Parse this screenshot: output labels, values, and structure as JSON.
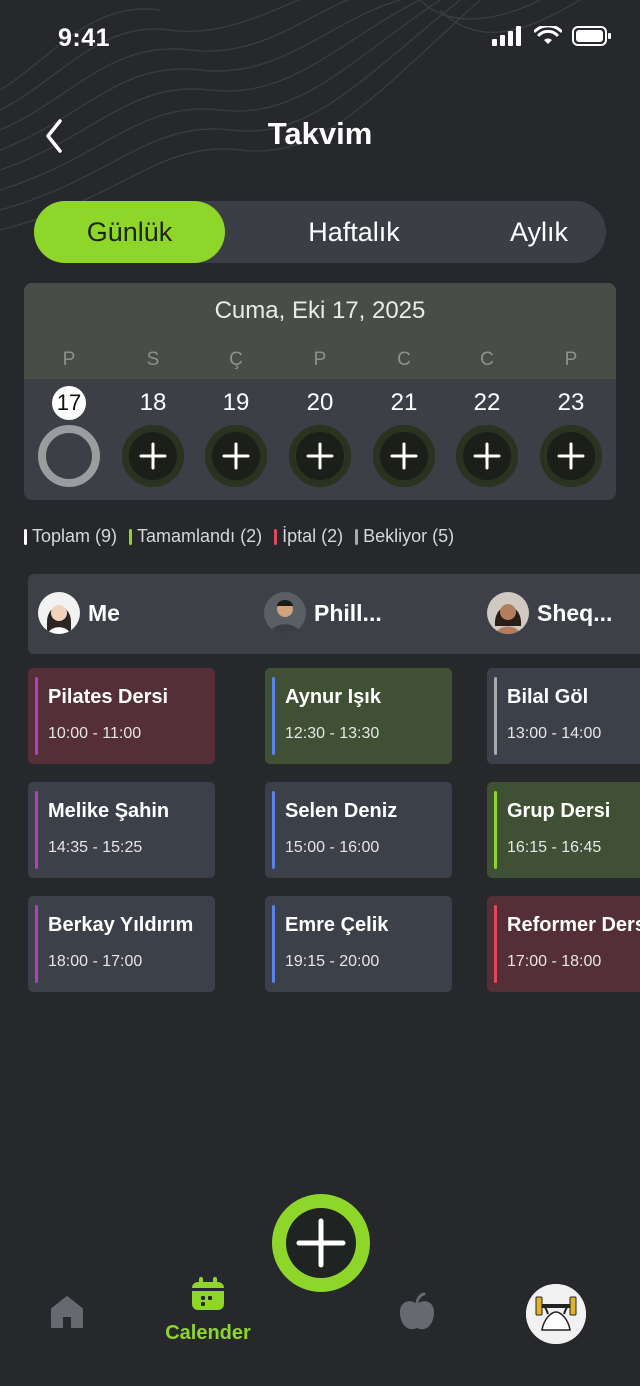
{
  "status_bar": {
    "time": "9:41"
  },
  "header": {
    "title": "Takvim"
  },
  "tabs": [
    {
      "label": "Günlük",
      "active": true
    },
    {
      "label": "Haftalık",
      "active": false
    },
    {
      "label": "Aylık",
      "active": false
    }
  ],
  "calendar": {
    "date_label": "Cuma, Eki 17, 2025",
    "days": [
      {
        "weekday": "P",
        "num": "17",
        "selected": true
      },
      {
        "weekday": "S",
        "num": "18",
        "selected": false
      },
      {
        "weekday": "Ç",
        "num": "19",
        "selected": false
      },
      {
        "weekday": "P",
        "num": "20",
        "selected": false
      },
      {
        "weekday": "C",
        "num": "21",
        "selected": false
      },
      {
        "weekday": "C",
        "num": "22",
        "selected": false
      },
      {
        "weekday": "P",
        "num": "23",
        "selected": false
      }
    ]
  },
  "legend": [
    {
      "label": "Toplam (9)",
      "color": "#ffffff"
    },
    {
      "label": "Tamamlandı (2)",
      "color": "#8ed629"
    },
    {
      "label": "İptal (2)",
      "color": "#e2485d"
    },
    {
      "label": "Bekliyor (5)",
      "color": "#a7a9ab"
    }
  ],
  "trainers": [
    {
      "name": "Me",
      "avatar": "avatar-woman"
    },
    {
      "name": "Phill...",
      "avatar": "avatar-man"
    },
    {
      "name": "Sheq...",
      "avatar": "avatar-woman"
    }
  ],
  "sessions": [
    [
      {
        "name": "Pilates Dersi",
        "time": "10:00 - 11:00",
        "bg": "#542f37",
        "bar": "#b43fc4"
      },
      {
        "name": "Melike Şahin",
        "time": "14:35 - 15:25",
        "bg": "#3c4049",
        "bar": "#b43fc4"
      },
      {
        "name": "Berkay Yıldırım",
        "time": "18:00 - 17:00",
        "bg": "#3c4049",
        "bar": "#b43fc4"
      }
    ],
    [
      {
        "name": "Aynur Işık",
        "time": "12:30 - 13:30",
        "bg": "#3f5035",
        "bar": "#5b82e8"
      },
      {
        "name": "Selen Deniz",
        "time": "15:00 - 16:00",
        "bg": "#3c4049",
        "bar": "#5b82e8"
      },
      {
        "name": "Emre Çelik",
        "time": "19:15 - 20:00",
        "bg": "#3c4049",
        "bar": "#5b82e8"
      }
    ],
    [
      {
        "name": "Bilal Göl",
        "time": "13:00 - 14:00",
        "bg": "#3c4049",
        "bar": "#a7a9ab"
      },
      {
        "name": "Grup Dersi",
        "time": "16:15 - 16:45",
        "bg": "#3f5035",
        "bar": "#8ed629"
      },
      {
        "name": "Reformer Dersi",
        "time": "17:00 - 18:00",
        "bg": "#542f37",
        "bar": "#e2485d"
      }
    ]
  ],
  "nav": {
    "home_icon": "home-icon",
    "calendar_label": "Calender",
    "add_icon": "plus-icon",
    "nutrition_icon": "apple-icon",
    "profile_icon": "avatar-dumbbell"
  },
  "colors": {
    "accent": "#8ed629",
    "background": "#26282c"
  }
}
